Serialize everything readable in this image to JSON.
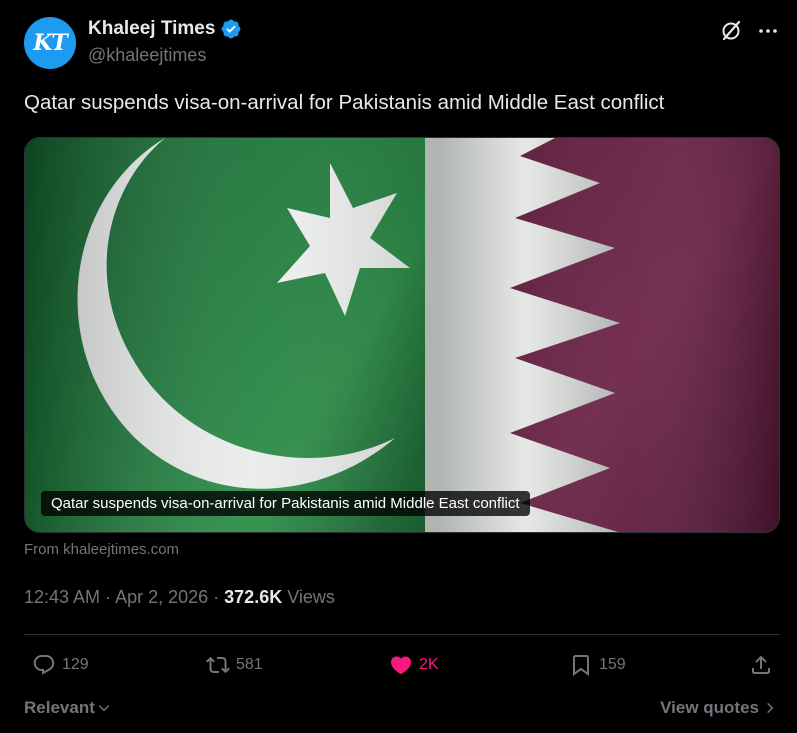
{
  "account": {
    "avatar_text": "KT",
    "name": "Khaleej Times",
    "handle": "@khaleejtimes",
    "verified": true
  },
  "tweet": {
    "text": "Qatar suspends visa-on-arrival for Pakistanis amid Middle East conflict"
  },
  "card": {
    "caption": "Qatar suspends visa-on-arrival for Pakistanis amid Middle East conflict",
    "source": "From khaleejtimes.com"
  },
  "meta": {
    "time": "12:43 AM",
    "sep1": " · ",
    "date": "Apr 2, 2026",
    "sep2": " · ",
    "views_count": "372.6K",
    "views_label": " Views"
  },
  "actions": {
    "replies": "129",
    "reposts": "581",
    "likes": "2K",
    "bookmarks": "159"
  },
  "footer": {
    "sort_label": "Relevant",
    "view_quotes_label": "View quotes"
  },
  "colors": {
    "accent": "#1d9bf0",
    "like": "#f91880",
    "muted": "#71767b",
    "text": "#e7e9ea",
    "background": "#000000"
  }
}
